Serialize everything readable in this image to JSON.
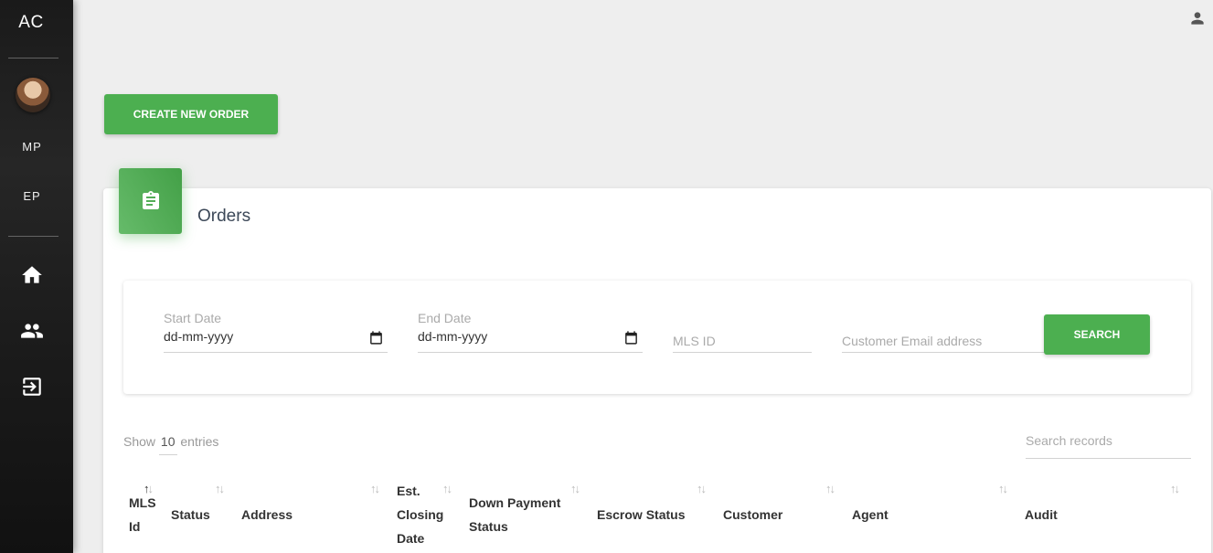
{
  "sidebar": {
    "logo": "AC",
    "user_initials": "MP",
    "edit_profile": "EP",
    "nav": [
      {
        "icon": "home-icon"
      },
      {
        "icon": "users-icon"
      },
      {
        "icon": "logout-icon"
      }
    ]
  },
  "header": {
    "user_icon": "person-icon"
  },
  "actions": {
    "create_order_label": "CREATE NEW ORDER"
  },
  "card": {
    "title": "Orders",
    "icon": "clipboard-icon"
  },
  "filters": {
    "start_date": {
      "label": "Start Date",
      "value": "dd-mm-yyyy"
    },
    "end_date": {
      "label": "End Date",
      "value": "dd-mm-yyyy"
    },
    "mls_id": {
      "placeholder": "MLS ID"
    },
    "customer_email": {
      "placeholder": "Customer Email address"
    },
    "search_label": "SEARCH"
  },
  "table_controls": {
    "show_label": "Show",
    "entries_count": "10",
    "entries_label": "entries",
    "search_placeholder": "Search records"
  },
  "table": {
    "columns": [
      {
        "l1": "MLS",
        "l2": "Id"
      },
      {
        "l1": "Status"
      },
      {
        "l1": "Address"
      },
      {
        "l1": "Est.",
        "l2": "Closing",
        "l3": "Date"
      },
      {
        "l1": "Down Payment",
        "l2": "Status"
      },
      {
        "l1": "Escrow Status"
      },
      {
        "l1": "Customer"
      },
      {
        "l1": "Agent"
      },
      {
        "l1": "Audit"
      }
    ]
  },
  "colors": {
    "accent": "#4caf50",
    "sidebar_bg": "#1c1c1c",
    "page_bg": "#eeeeee"
  }
}
